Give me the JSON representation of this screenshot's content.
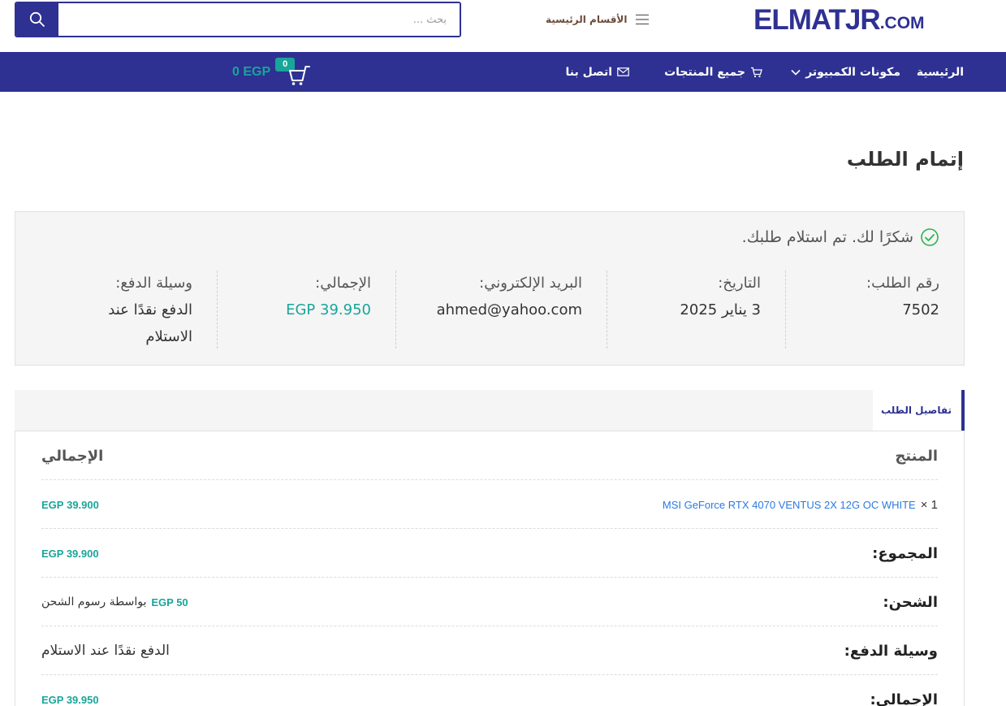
{
  "header": {
    "search": {
      "placeholder": "بحث ..."
    },
    "main_categories": "الأقسام الرئيسية",
    "logo_main": "ELMATJR",
    "logo_suffix": ".COM"
  },
  "nav": {
    "items": [
      {
        "label": "الرئيسية"
      },
      {
        "label": "مكونات الكمبيوتر"
      },
      {
        "label": "جميع المنتجات"
      },
      {
        "label": "اتصل بنا"
      }
    ],
    "cart_count": "0",
    "cart_total": "0 EGP"
  },
  "page": {
    "title": "إتمام الطلب",
    "thanks": "شكرًا لك. تم استلام طلبك."
  },
  "overview": {
    "order_number_label": "رقم الطلب:",
    "order_number": "7502",
    "date_label": "التاريخ:",
    "date": "3 يناير 2025",
    "email_label": "البريد الإلكتروني:",
    "email": "ahmed@yahoo.com",
    "total_label": "الإجمالي:",
    "total": "39.950 EGP",
    "payment_label": "وسيلة الدفع:",
    "payment_line1": "الدفع نقدًا عند",
    "payment_line2": "الاستلام"
  },
  "details": {
    "tab_label": "تفاصيل الطلب",
    "col_product": "المنتج",
    "col_total": "الإجمالي",
    "item": {
      "qty": "1 ×",
      "name": "MSI GeForce RTX 4070 VENTUS 2X 12G OC WHITE",
      "total": "39.900 EGP"
    },
    "subtotal_label": "المجموع:",
    "subtotal": "EGP 39.900",
    "shipping_label": "الشحن:",
    "shipping_amount": "EGP 50",
    "shipping_method": "بواسطة رسوم الشحن",
    "payment_label": "وسيلة الدفع:",
    "payment_value": "الدفع نقدًا عند الاستلام",
    "grand_total_label": "الإجمالي:",
    "grand_total": "EGP 39.950"
  },
  "colors": {
    "brand": "#2e3192",
    "accent": "#19a59a",
    "link": "#2a7ae2",
    "success": "#2fb34a"
  }
}
